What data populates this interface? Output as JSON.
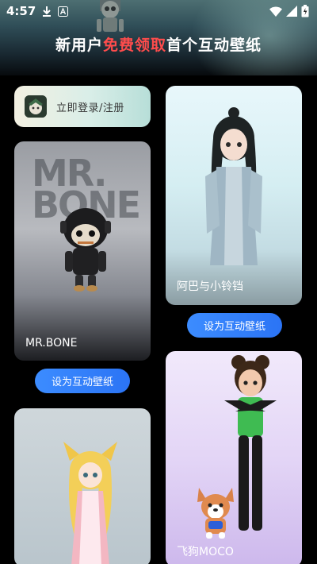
{
  "status_bar": {
    "time": "4:57",
    "icons": [
      "download-icon",
      "app-a-icon",
      "wifi-icon",
      "signal-icon",
      "battery-icon"
    ]
  },
  "banner": {
    "title_prefix": "新用户",
    "title_highlight": "免费领取",
    "title_suffix": "首个互动壁纸",
    "highlight_color": "#ff4c4c"
  },
  "login": {
    "label": "立即登录/注册"
  },
  "wallpapers": [
    {
      "name": "MR.BONE",
      "watermark": "MR.\nBONE",
      "button": "设为互动壁纸"
    },
    {
      "name": "阿巴与小铃铛",
      "button": "设为互动壁纸"
    },
    {
      "name": "飞狗MOCO"
    },
    {
      "name": ""
    }
  ],
  "colors": {
    "button_blue": "#2b74f5",
    "background": "#000000"
  }
}
